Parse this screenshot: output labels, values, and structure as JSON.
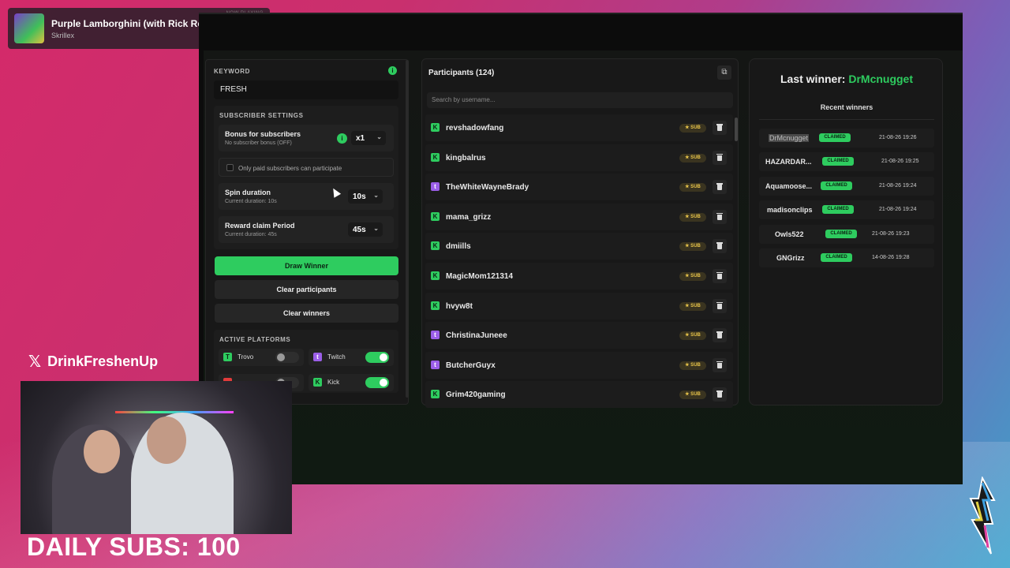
{
  "now_playing": {
    "tag": "NOW PLAYING",
    "title": "Purple Lamborghini (with Rick Ross)",
    "artist": "Skrillex"
  },
  "left_panel": {
    "keyword_label": "KEYWORD",
    "keyword_value": "FRESH",
    "subscriber_settings_label": "SUBSCRIBER SETTINGS",
    "bonus_title": "Bonus for subscribers",
    "bonus_sub": "No subscriber bonus (OFF)",
    "bonus_value": "x1",
    "paid_only_label": "Only paid subscribers can participate",
    "spin_title": "Spin duration",
    "spin_sub": "Current duration: 10s",
    "spin_value": "10s",
    "reward_title": "Reward claim Period",
    "reward_sub": "Current duration: 45s",
    "reward_value": "45s",
    "draw_button": "Draw Winner",
    "clear_participants_button": "Clear participants",
    "clear_winners_button": "Clear winners",
    "active_platforms_label": "ACTIVE PLATFORMS",
    "platforms": [
      {
        "name": "Trovo",
        "enabled": false
      },
      {
        "name": "Twitch",
        "enabled": true
      },
      {
        "name": "",
        "enabled": false
      },
      {
        "name": "Kick",
        "enabled": true
      }
    ]
  },
  "participants": {
    "title": "Participants (124)",
    "search_placeholder": "Search by username...",
    "sub_badge": "★ SUB",
    "items": [
      {
        "name": "revshadowfang",
        "platform": "kick"
      },
      {
        "name": "kingbalrus",
        "platform": "kick"
      },
      {
        "name": "TheWhiteWayneBrady",
        "platform": "twitch"
      },
      {
        "name": "mama_grizz",
        "platform": "kick"
      },
      {
        "name": "dmiills",
        "platform": "kick"
      },
      {
        "name": "MagicMom121314",
        "platform": "kick"
      },
      {
        "name": "hvyw8t",
        "platform": "kick"
      },
      {
        "name": "ChristinaJuneee",
        "platform": "twitch"
      },
      {
        "name": "ButcherGuyx",
        "platform": "twitch"
      },
      {
        "name": "Grim420gaming",
        "platform": "kick"
      }
    ]
  },
  "winners": {
    "last_winner_label": "Last winner:",
    "last_winner_name": "DrMcnugget",
    "recent_title": "Recent winners",
    "claimed_label": "CLAIMED",
    "items": [
      {
        "name": "DrMcnugget",
        "date": "21-08-26 19:26"
      },
      {
        "name": "HAZARDAR...",
        "date": "21-08-26 19:25"
      },
      {
        "name": "Aquamoose...",
        "date": "21-08-26 19:24"
      },
      {
        "name": "madisonclips",
        "date": "21-08-26 19:24"
      },
      {
        "name": "Owls522",
        "date": "21-08-26 19:23"
      },
      {
        "name": "GNGrizz",
        "date": "14-08-26 19:28"
      }
    ]
  },
  "overlay": {
    "x_handle": "DrinkFreshenUp",
    "daily_subs": "DAILY SUBS: 100"
  },
  "colors": {
    "accent_green": "#2ecc5f",
    "twitch_purple": "#9b5ee8",
    "sub_gold": "#e8c44a"
  }
}
